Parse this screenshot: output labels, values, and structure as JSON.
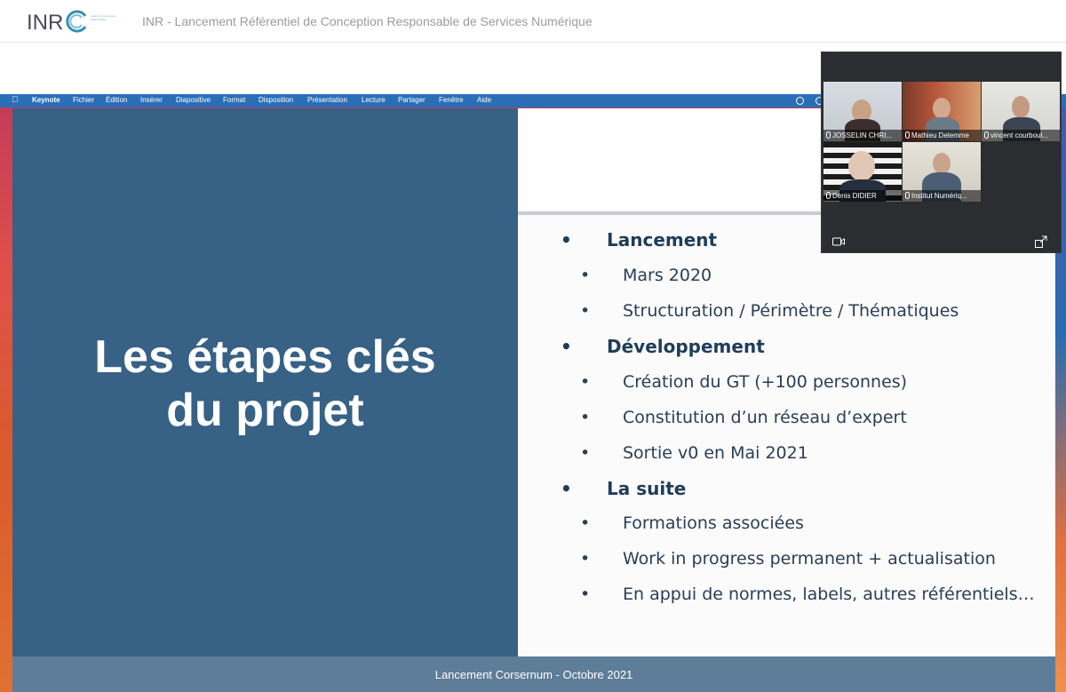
{
  "header": {
    "logo_text": "INR",
    "logo_caption": "Institut du Numérique Responsable",
    "title": "INR - Lancement Référentiel de Conception Responsable de Services Numérique"
  },
  "menubar": {
    "app": "Keynote",
    "items": [
      "Fichier",
      "Édition",
      "Insérer",
      "Diapositive",
      "Format",
      "Disposition",
      "Présentation",
      "Lecture",
      "Partager",
      "Fenêtre",
      "Aide"
    ]
  },
  "slide": {
    "title_line1": "Les étapes clés",
    "title_line2": "du projet",
    "footer": "Lancement Corsernum - Octobre 2021",
    "bullets": [
      {
        "level": 1,
        "text": "Lancement"
      },
      {
        "level": 2,
        "text": "Mars 2020"
      },
      {
        "level": 2,
        "text": "Structuration / Périmètre / Thématiques"
      },
      {
        "level": 1,
        "text": "Développement"
      },
      {
        "level": 2,
        "text": "Création du GT (+100 personnes)"
      },
      {
        "level": 2,
        "text": "Constitution d’un réseau d’expert"
      },
      {
        "level": 2,
        "text": "Sortie v0 en Mai 2021"
      },
      {
        "level": 1,
        "text": "La suite"
      },
      {
        "level": 2,
        "text": "Formations associées"
      },
      {
        "level": 2,
        "text": "Work in progress permanent + actualisation"
      },
      {
        "level": 2,
        "text": "En appui de normes, labels, autres référentiels…"
      }
    ]
  },
  "video_call": {
    "participants": [
      {
        "name": "JOSSELIN CHRI..."
      },
      {
        "name": "Mathieu Delemme"
      },
      {
        "name": "vincent courboul..."
      },
      {
        "name": "Denis DIDIER"
      },
      {
        "name": "Institut Numériq..."
      }
    ],
    "camera_icon": "camera-icon",
    "expand_icon": "expand-icon"
  },
  "colors": {
    "slide_blue": "#376185",
    "bullet_text": "#1f3d5a",
    "menubar": "#2a6fb6"
  }
}
